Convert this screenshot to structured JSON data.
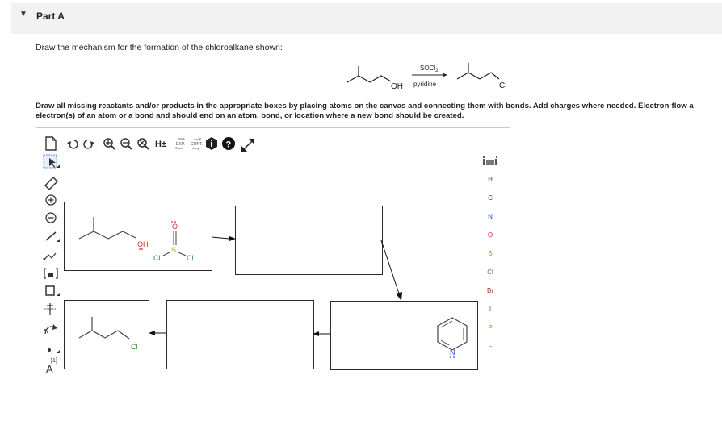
{
  "part": {
    "title": "Part A",
    "caret": "▼"
  },
  "question": {
    "text": "Draw the mechanism for the formation of the chloroalkane shown:",
    "instructions": "Draw all missing reactants and/or products in the appropriate boxes by placing atoms on the canvas and connecting them with bonds. Add charges where needed. Electron-flow a",
    "instructions_line2": "electron(s) of an atom or a bond and should end on an atom, bond, or location where a new bond should be created."
  },
  "reaction": {
    "reagent": "SOCl",
    "reagent_sub": "2",
    "condition": "pyridine",
    "reactant_group": "OH",
    "product_group": "Cl"
  },
  "toolbar": {
    "h_label": "H±",
    "exp_label": "EXP.",
    "cont_label": "CONT."
  },
  "left_tools": {
    "count_label": "[1]",
    "text_tool": "A"
  },
  "periodic": {
    "elements": [
      "H",
      "C",
      "N",
      "O",
      "S",
      "Cl",
      "Br",
      "I",
      "P",
      "F"
    ]
  },
  "colors": {
    "N": "#2a4fd6",
    "O": "#d62a2a",
    "S": "#b59a00",
    "Cl": "#2e8b2e",
    "Br": "#8b3a1a",
    "I": "#7a2fa0",
    "P": "#d27d00",
    "F": "#2e9b9b",
    "H": "#444444",
    "C": "#444444"
  },
  "mechanism": {
    "box1": {
      "oh_label": "OH",
      "o_label": "O",
      "s_label": "S",
      "cl_label": "Cl"
    },
    "box4": {
      "n_label": "N"
    },
    "box5": {
      "cl_label": "Cl"
    }
  }
}
